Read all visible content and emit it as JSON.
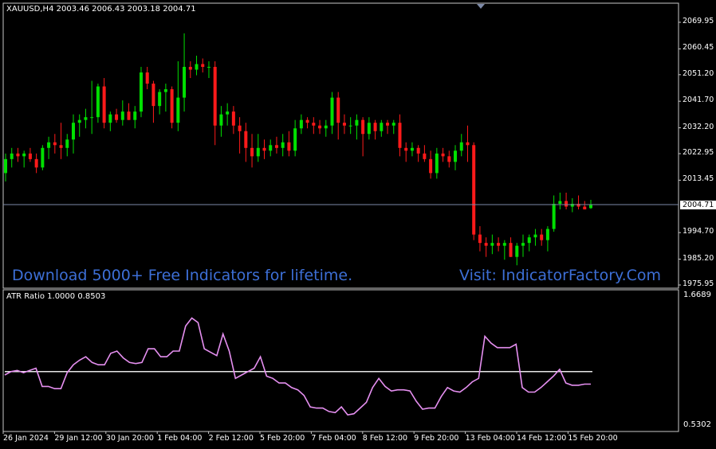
{
  "main": {
    "title": "XAUUSD,H4  2003.46 2006.43 2003.18 2004.71",
    "price_ticks": [
      "2069.95",
      "2060.45",
      "2051.20",
      "2041.70",
      "2032.20",
      "2022.95",
      "2013.45",
      "1994.70",
      "1985.20",
      "1975.95"
    ],
    "current_price": "2004.71",
    "promo_left": "Download 5000+ Free Indicators for lifetime.",
    "promo_right": "Visit: IndicatorFactory.Com"
  },
  "indicator": {
    "title": "ATR Ratio 1.0000 0.8503",
    "top_label": "1.6689",
    "bottom_label": "0.5302",
    "level_value": 1.0
  },
  "time_axis": [
    "26 Jan 2024",
    "29 Jan 12:00",
    "30 Jan 20:00",
    "1 Feb 04:00",
    "2 Feb 12:00",
    "5 Feb 20:00",
    "7 Feb 04:00",
    "8 Feb 12:00",
    "9 Feb 20:00",
    "13 Feb 04:00",
    "14 Feb 12:00",
    "15 Feb 20:00"
  ],
  "colors": {
    "bull": "#00e000",
    "bear": "#ff1a1a",
    "atr_line": "#e58ff0",
    "level_line": "#e6e6e6",
    "bid_line": "#7d8aa8",
    "promo_text": "#3d6fd6"
  },
  "chart_data": {
    "type": "candlestick",
    "symbol": "XAUUSD",
    "timeframe": "H4",
    "ylim": [
      1975.95,
      2069.95
    ],
    "candles": [
      [
        2016,
        2023,
        2013,
        2021
      ],
      [
        2021,
        2025,
        2018,
        2023
      ],
      [
        2023,
        2025,
        2020,
        2022
      ],
      [
        2022,
        2024,
        2018,
        2023
      ],
      [
        2023,
        2025,
        2020,
        2021
      ],
      [
        2021,
        2023,
        2016,
        2018
      ],
      [
        2018,
        2026,
        2017,
        2025
      ],
      [
        2025,
        2029,
        2021,
        2027
      ],
      [
        2027,
        2030,
        2023,
        2026
      ],
      [
        2026,
        2034,
        2021,
        2025
      ],
      [
        2025,
        2030,
        2022,
        2028
      ],
      [
        2028,
        2037,
        2023,
        2034
      ],
      [
        2034,
        2037,
        2029,
        2035
      ],
      [
        2035,
        2039,
        2032,
        2036
      ],
      [
        2036,
        2049,
        2030,
        2036
      ],
      [
        2036,
        2048,
        2034,
        2047
      ],
      [
        2047,
        2050,
        2032,
        2034
      ],
      [
        2034,
        2038,
        2031,
        2037
      ],
      [
        2037,
        2039,
        2034,
        2035
      ],
      [
        2035,
        2042,
        2033,
        2038
      ],
      [
        2038,
        2041,
        2035,
        2035
      ],
      [
        2035,
        2040,
        2032,
        2038
      ],
      [
        2038,
        2054,
        2036,
        2052
      ],
      [
        2052,
        2054,
        2046,
        2048
      ],
      [
        2048,
        2049,
        2034,
        2040
      ],
      [
        2040,
        2046,
        2037,
        2045
      ],
      [
        2045,
        2048,
        2038,
        2046
      ],
      [
        2046,
        2047,
        2032,
        2034
      ],
      [
        2034,
        2056,
        2031,
        2043
      ],
      [
        2043,
        2066,
        2038,
        2054
      ],
      [
        2054,
        2056,
        2050,
        2053
      ],
      [
        2053,
        2058,
        2051,
        2055
      ],
      [
        2055,
        2057,
        2052,
        2054
      ],
      [
        2054,
        2056,
        2050,
        2054
      ],
      [
        2054,
        2056,
        2026,
        2033
      ],
      [
        2033,
        2040,
        2029,
        2037
      ],
      [
        2037,
        2041,
        2033,
        2038
      ],
      [
        2038,
        2040,
        2030,
        2033
      ],
      [
        2033,
        2036,
        2023,
        2031
      ],
      [
        2031,
        2034,
        2020,
        2025
      ],
      [
        2025,
        2030,
        2018,
        2022
      ],
      [
        2022,
        2030,
        2020,
        2025
      ],
      [
        2025,
        2028,
        2021,
        2024
      ],
      [
        2024,
        2028,
        2022,
        2026
      ],
      [
        2026,
        2029,
        2023,
        2025
      ],
      [
        2025,
        2030,
        2022,
        2027
      ],
      [
        2027,
        2031,
        2022,
        2024
      ],
      [
        2024,
        2035,
        2022,
        2032
      ],
      [
        2032,
        2037,
        2030,
        2035
      ],
      [
        2035,
        2036,
        2032,
        2034
      ],
      [
        2034,
        2036,
        2030,
        2033
      ],
      [
        2033,
        2035,
        2030,
        2032
      ],
      [
        2032,
        2035,
        2029,
        2033
      ],
      [
        2033,
        2045,
        2030,
        2043
      ],
      [
        2043,
        2045,
        2028,
        2034
      ],
      [
        2034,
        2037,
        2030,
        2033
      ],
      [
        2033,
        2036,
        2030,
        2033
      ],
      [
        2033,
        2037,
        2028,
        2035
      ],
      [
        2035,
        2036,
        2022,
        2030
      ],
      [
        2030,
        2036,
        2028,
        2034
      ],
      [
        2034,
        2035,
        2028,
        2031
      ],
      [
        2031,
        2035,
        2029,
        2034
      ],
      [
        2034,
        2035,
        2030,
        2033
      ],
      [
        2033,
        2035,
        2030,
        2034
      ],
      [
        2034,
        2037,
        2022,
        2025
      ],
      [
        2025,
        2027,
        2020,
        2024
      ],
      [
        2024,
        2027,
        2022,
        2025
      ],
      [
        2025,
        2026,
        2020,
        2023
      ],
      [
        2023,
        2026,
        2020,
        2021
      ],
      [
        2021,
        2024,
        2014,
        2016
      ],
      [
        2016,
        2025,
        2014,
        2023
      ],
      [
        2023,
        2025,
        2020,
        2022
      ],
      [
        2022,
        2024,
        2018,
        2020
      ],
      [
        2020,
        2026,
        2017,
        2024
      ],
      [
        2024,
        2030,
        2022,
        2027
      ],
      [
        2027,
        2033,
        2020,
        2026
      ],
      [
        2026,
        2027,
        1992,
        1994
      ],
      [
        1994,
        1997,
        1988,
        1991
      ],
      [
        1991,
        1993,
        1986,
        1990
      ],
      [
        1990,
        1994,
        1987,
        1991
      ],
      [
        1991,
        1993,
        1988,
        1990
      ],
      [
        1990,
        1992,
        1985,
        1991
      ],
      [
        1991,
        1993,
        1986,
        1986
      ],
      [
        1986,
        1991,
        1983,
        1990
      ],
      [
        1990,
        1994,
        1986,
        1991
      ],
      [
        1991,
        1994,
        1988,
        1993
      ],
      [
        1993,
        1996,
        1990,
        1994
      ],
      [
        1994,
        1996,
        1990,
        1992
      ],
      [
        1992,
        1997,
        1988,
        1996
      ],
      [
        1996,
        2008,
        1995,
        2005
      ],
      [
        2005,
        2009,
        2003,
        2006
      ],
      [
        2006,
        2009,
        2003,
        2004
      ],
      [
        2004,
        2007,
        2002,
        2005
      ],
      [
        2005,
        2008,
        2003,
        2004
      ],
      [
        2004,
        2006,
        2003,
        2003
      ],
      [
        2003.46,
        2006.43,
        2003.18,
        2004.71
      ]
    ],
    "atr_ratio": {
      "ylim": [
        0.5302,
        1.6689
      ],
      "level": 1.0,
      "values": [
        0.97,
        1.0,
        1.01,
        0.99,
        1.01,
        1.03,
        0.87,
        0.87,
        0.85,
        0.85,
        0.99,
        1.06,
        1.1,
        1.13,
        1.08,
        1.06,
        1.06,
        1.16,
        1.18,
        1.12,
        1.08,
        1.07,
        1.08,
        1.2,
        1.2,
        1.13,
        1.13,
        1.18,
        1.18,
        1.4,
        1.47,
        1.43,
        1.2,
        1.17,
        1.14,
        1.33,
        1.18,
        0.94,
        0.97,
        1.0,
        1.03,
        1.13,
        0.96,
        0.94,
        0.9,
        0.9,
        0.86,
        0.84,
        0.79,
        0.69,
        0.68,
        0.68,
        0.65,
        0.64,
        0.69,
        0.62,
        0.63,
        0.68,
        0.73,
        0.86,
        0.94,
        0.87,
        0.83,
        0.84,
        0.84,
        0.83,
        0.74,
        0.67,
        0.68,
        0.68,
        0.78,
        0.86,
        0.83,
        0.82,
        0.86,
        0.91,
        0.94,
        1.31,
        1.25,
        1.21,
        1.21,
        1.21,
        1.24,
        0.86,
        0.82,
        0.82,
        0.86,
        0.91,
        0.96,
        1.02,
        0.9,
        0.88,
        0.88,
        0.89,
        0.89
      ]
    }
  }
}
